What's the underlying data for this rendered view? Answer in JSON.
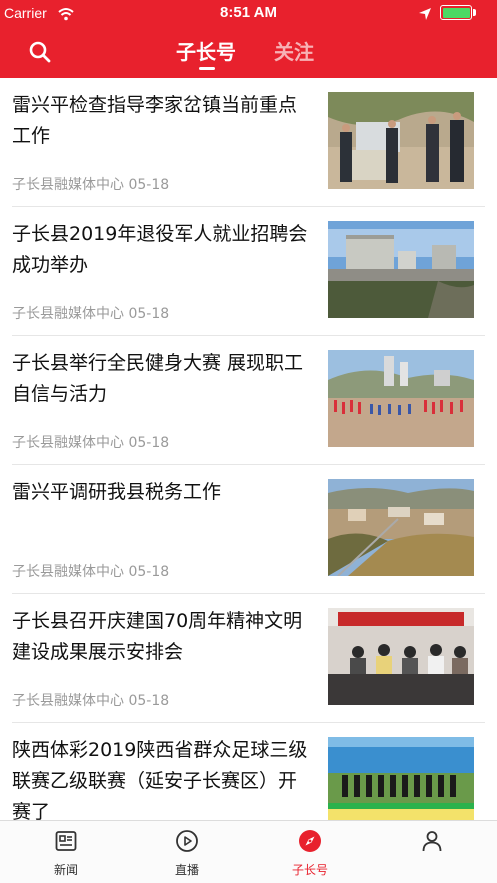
{
  "status_bar": {
    "carrier": "Carrier",
    "time": "8:51 AM"
  },
  "header": {
    "tabs": [
      {
        "label": "子长号",
        "active": true
      },
      {
        "label": "关注",
        "active": false
      }
    ],
    "search_icon": "search-icon"
  },
  "colors": {
    "brand_red": "#e8212d",
    "meta_gray": "#9a9a9a",
    "battery_green": "#4cd964"
  },
  "feed": {
    "items": [
      {
        "title": "雷兴平检查指导李家岔镇当前重点工作",
        "source": "子长县融媒体中心",
        "date": "05-18"
      },
      {
        "title": "子长县2019年退役军人就业招聘会成功举办",
        "source": "子长县融媒体中心",
        "date": "05-18"
      },
      {
        "title": "子长县举行全民健身大赛 展现职工自信与活力",
        "source": "子长县融媒体中心",
        "date": "05-18"
      },
      {
        "title": "雷兴平调研我县税务工作",
        "source": "子长县融媒体中心",
        "date": "05-18"
      },
      {
        "title": "子长县召开庆建国70周年精神文明建设成果展示安排会",
        "source": "子长县融媒体中心",
        "date": "05-18"
      },
      {
        "title": "陕西体彩2019陕西省群众足球三级联赛乙级联赛（延安子长赛区）开赛了",
        "source": "",
        "date": ""
      }
    ]
  },
  "tabbar": {
    "items": [
      {
        "label": "新闻",
        "icon": "newspaper-icon",
        "active": false
      },
      {
        "label": "直播",
        "icon": "play-icon",
        "active": false
      },
      {
        "label": "子长号",
        "icon": "compass-icon",
        "active": true
      },
      {
        "label": "",
        "icon": "person-icon",
        "active": false
      }
    ]
  }
}
